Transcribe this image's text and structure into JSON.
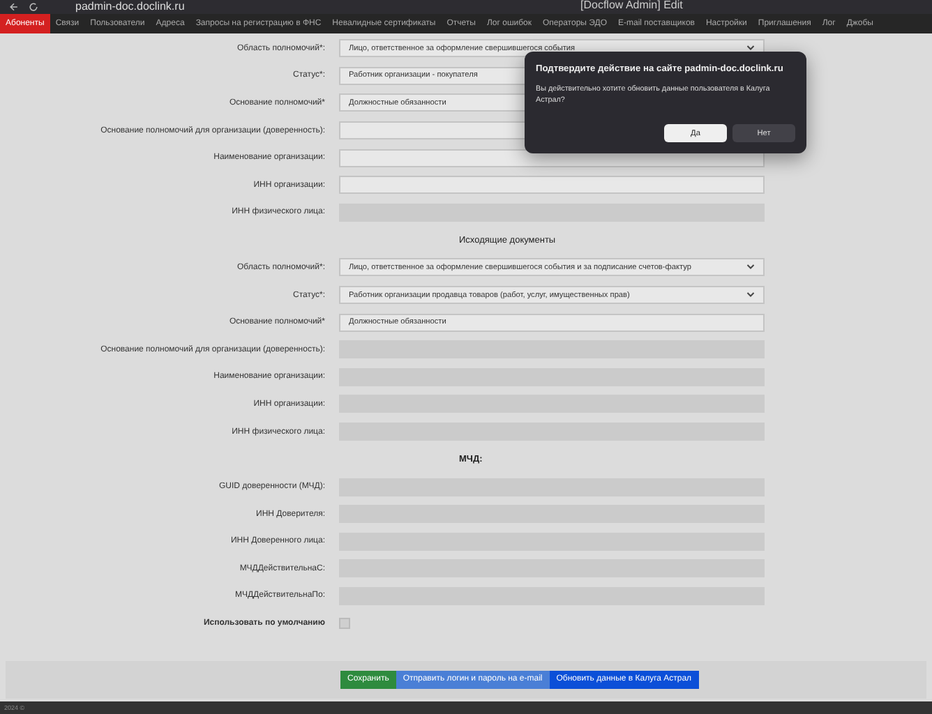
{
  "browser": {
    "url": "padmin-doc.doclink.ru",
    "title": "[Docflow Admin] Edit"
  },
  "nav": [
    {
      "label": "Абоненты",
      "selected": true
    },
    {
      "label": "Связи",
      "selected": false
    },
    {
      "label": "Пользователи",
      "selected": false
    },
    {
      "label": "Адреса",
      "selected": false
    },
    {
      "label": "Запросы на регистрацию в ФНС",
      "selected": false
    },
    {
      "label": "Невалидные сертификаты",
      "selected": false
    },
    {
      "label": "Отчеты",
      "selected": false
    },
    {
      "label": "Лог ошибок",
      "selected": false
    },
    {
      "label": "Операторы ЭДО",
      "selected": false
    },
    {
      "label": "E-mail поставщиков",
      "selected": false
    },
    {
      "label": "Настройки",
      "selected": false
    },
    {
      "label": "Приглашения",
      "selected": false
    },
    {
      "label": "Лог",
      "selected": false
    },
    {
      "label": "Джобы",
      "selected": false
    }
  ],
  "sections": [
    {
      "rows": [
        {
          "label": "Область полномочий*:",
          "kind": "select",
          "value": "Лицо, ответственное за оформление свершившегося события",
          "disabled": false
        },
        {
          "label": "Статус*:",
          "kind": "input",
          "value": "Работник организации - покупателя",
          "disabled": false
        },
        {
          "label": "Основание полномочий*",
          "kind": "input",
          "value": "Должностные обязанности",
          "disabled": false
        },
        {
          "label": "Основание полномочий для организации (доверенность):",
          "kind": "input",
          "value": "",
          "disabled": false
        },
        {
          "label": "Наименование организации:",
          "kind": "input",
          "value": "",
          "disabled": false
        },
        {
          "label": "ИНН организации:",
          "kind": "input",
          "value": "",
          "disabled": false
        },
        {
          "label": "ИНН физического лица:",
          "kind": "input",
          "value": "",
          "disabled": true
        }
      ]
    },
    {
      "heading": "Исходящие документы",
      "rows": [
        {
          "label": "Область полномочий*:",
          "kind": "select",
          "value": "Лицо, ответственное за оформление свершившегося события и за подписание счетов-фактур",
          "disabled": false
        },
        {
          "label": "Статус*:",
          "kind": "select",
          "value": "Работник организации продавца товаров (работ, услуг, имущественных прав)",
          "disabled": false
        },
        {
          "label": "Основание полномочий*",
          "kind": "input",
          "value": "Должностные обязанности",
          "disabled": false
        },
        {
          "label": "Основание полномочий для организации (доверенность):",
          "kind": "input",
          "value": "",
          "disabled": true
        },
        {
          "label": "Наименование организации:",
          "kind": "input",
          "value": "",
          "disabled": true
        },
        {
          "label": "ИНН организации:",
          "kind": "input",
          "value": "",
          "disabled": true
        },
        {
          "label": "ИНН физического лица:",
          "kind": "input",
          "value": "",
          "disabled": true
        }
      ]
    },
    {
      "heading": "МЧД:",
      "bold": true,
      "rows": [
        {
          "label": "GUID доверенности (МЧД):",
          "kind": "input",
          "value": "",
          "disabled": true
        },
        {
          "label": "ИНН Доверителя:",
          "kind": "input",
          "value": "",
          "disabled": true
        },
        {
          "label": "ИНН Доверенного лица:",
          "kind": "input",
          "value": "",
          "disabled": true
        },
        {
          "label": "МЧДДействительнаС:",
          "kind": "input",
          "value": "",
          "disabled": true
        },
        {
          "label": "МЧДДействительнаПо:",
          "kind": "input",
          "value": "",
          "disabled": true
        },
        {
          "label": "Использовать по умолчанию",
          "kind": "checkbox",
          "checked": false,
          "disabled": true
        }
      ]
    }
  ],
  "buttons": [
    {
      "label": "Сохранить",
      "color": "#2e8b3e"
    },
    {
      "label": "Отправить логин и пароль на e-mail",
      "color": "#4a7fd6"
    },
    {
      "label": "Обновить данные в Калуга Астрал",
      "color": "#0b4fd8"
    }
  ],
  "footer": "2024 ©",
  "dialog": {
    "title": "Подтвердите действие на сайте padmin-doc.doclink.ru",
    "message": "Вы действительно хотите обновить данные пользователя в Калуга Астрал?",
    "buttons": [
      {
        "label": "Да",
        "primary": true
      },
      {
        "label": "Нет",
        "primary": false
      }
    ]
  }
}
